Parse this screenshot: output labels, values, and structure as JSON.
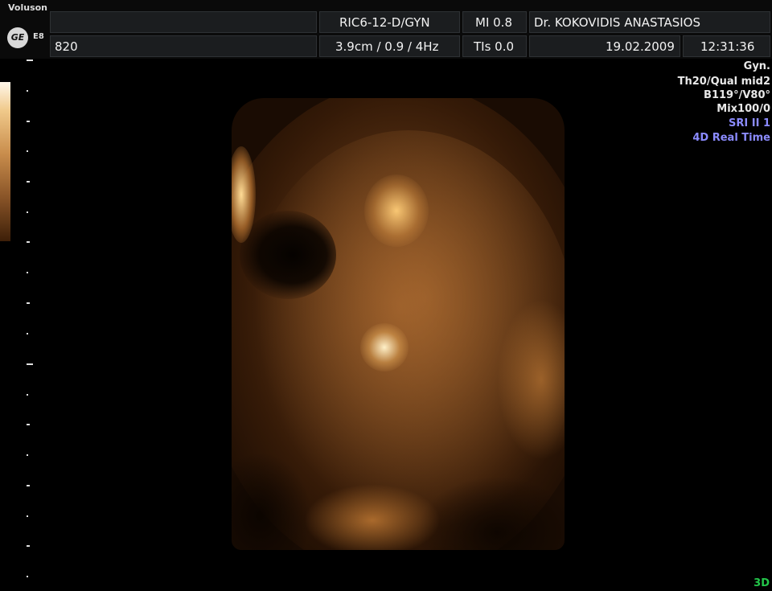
{
  "header": {
    "brand": "Voluson",
    "logo_text": "GE",
    "model": "E8",
    "frame_number": "820",
    "probe_preset": "RIC6-12-D/GYN",
    "depth_settings": "3.9cm / 0.9 /  4Hz",
    "mi": "MI  0.8",
    "tis": "TIs  0.0",
    "operator": "Dr. KOKOVIDIS ANASTASIOS",
    "date": "19.02.2009",
    "time": "12:31:36"
  },
  "side_info": {
    "lines": [
      "Gyn.",
      "Th20/Qual mid2",
      "B119°/V80°",
      "Mix100/0"
    ],
    "highlight_lines": [
      "SRI II 1",
      "4D Real Time"
    ]
  },
  "mode_label": "3D",
  "colors": {
    "highlight_text": "#8b8bff",
    "mode_label": "#23c64a",
    "scan_tint": "#c98d4c"
  }
}
